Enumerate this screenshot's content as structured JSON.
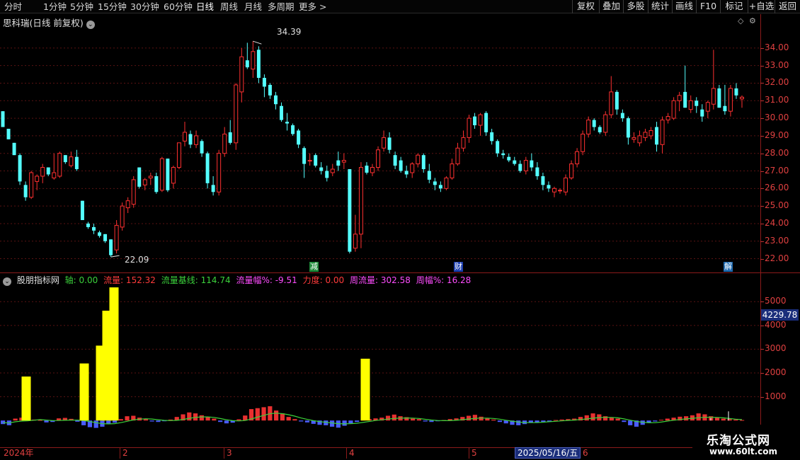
{
  "toolbar": {
    "periods": [
      "分时",
      "1分钟",
      "5分钟",
      "15分钟",
      "30分钟",
      "60分钟",
      "日线",
      "周线",
      "月线",
      "多周期",
      "更多 >"
    ],
    "active_period": "日线",
    "actions": [
      "复权",
      "叠加",
      "多股",
      "统计",
      "画线",
      "F10",
      "+自选",
      "标记",
      "返回"
    ]
  },
  "price_panel": {
    "title": "思科瑞(日线 前复权)",
    "y_labels": [
      "34.00",
      "33.00",
      "32.00",
      "31.00",
      "30.00",
      "29.00",
      "28.00",
      "27.00",
      "26.00",
      "25.00",
      "24.00",
      "23.00",
      "22.00"
    ],
    "high_marker": "34.39",
    "low_marker": "22.09",
    "events": [
      {
        "label": "减",
        "color": "#1f8a3a"
      },
      {
        "label": "财",
        "color": "#1e40b0"
      },
      {
        "label": "解",
        "color": "#1f6ab0"
      }
    ]
  },
  "indicator_panel": {
    "name": "股朋指标网",
    "legend": [
      {
        "label": "轴: 0.00",
        "color": "#3bd13b"
      },
      {
        "label": "流量: 152.32",
        "color": "#ff3b3b"
      },
      {
        "label": "流量基线: 114.74",
        "color": "#3bd13b"
      },
      {
        "label": "流量幅%: -9.51",
        "color": "#ff4cff"
      },
      {
        "label": "力度: 0.00",
        "color": "#ff3b3b"
      },
      {
        "label": "周流量: 302.58",
        "color": "#ff4cff"
      },
      {
        "label": "周幅%: 16.28",
        "color": "#ff4cff"
      }
    ],
    "y_labels": [
      "5000",
      "4000",
      "3000",
      "2000",
      "1000"
    ],
    "current_value": "4229.78"
  },
  "date_axis": {
    "labels": [
      "2024年",
      "2",
      "3",
      "4",
      "5",
      "6"
    ],
    "cursor_date": "2025/05/16/五"
  },
  "watermark": {
    "line1": "乐淘公式网",
    "line2": "www.60lt.com"
  },
  "colors": {
    "up": "#ff3030",
    "down": "#54ffff",
    "spike": "#ffff00",
    "neg_bar": "#4a5cff",
    "baseline": "#3bd13b"
  },
  "chart_data": {
    "type": "candlestick",
    "ylim": [
      21.7,
      34.8
    ],
    "candles": [
      [
        30.4,
        30.4,
        29.5,
        29.5
      ],
      [
        29.4,
        29.4,
        28.8,
        28.8
      ],
      [
        28.6,
        28.6,
        27.9,
        27.9
      ],
      [
        27.9,
        28.0,
        26.2,
        26.4
      ],
      [
        26.2,
        26.4,
        25.3,
        25.5
      ],
      [
        25.5,
        27.0,
        25.4,
        26.9
      ],
      [
        26.4,
        26.8,
        25.9,
        26.7
      ],
      [
        26.7,
        27.4,
        26.3,
        27.2
      ],
      [
        27.2,
        27.2,
        26.7,
        26.8
      ],
      [
        26.6,
        28.0,
        26.5,
        26.9
      ],
      [
        26.7,
        28.1,
        26.6,
        28.0
      ],
      [
        27.9,
        27.9,
        27.4,
        27.5
      ],
      [
        27.3,
        28.1,
        27.2,
        27.8
      ],
      [
        27.8,
        28.2,
        27.0,
        27.1
      ],
      [
        25.3,
        25.3,
        24.3,
        24.2
      ],
      [
        24.0,
        24.1,
        23.7,
        23.8
      ],
      [
        23.8,
        24.0,
        23.4,
        23.6
      ],
      [
        23.5,
        23.6,
        23.2,
        23.3
      ],
      [
        23.4,
        23.4,
        22.9,
        23.0
      ],
      [
        23.1,
        23.1,
        22.1,
        22.2
      ],
      [
        22.5,
        24.2,
        22.3,
        23.9
      ],
      [
        23.8,
        25.2,
        23.6,
        25.0
      ],
      [
        24.9,
        25.5,
        24.6,
        25.3
      ],
      [
        25.1,
        26.7,
        24.9,
        26.5
      ],
      [
        27.2,
        27.2,
        26.0,
        26.1
      ],
      [
        26.2,
        26.6,
        25.9,
        26.5
      ],
      [
        26.6,
        26.9,
        26.2,
        26.7
      ],
      [
        26.7,
        26.9,
        25.7,
        25.8
      ],
      [
        25.9,
        27.8,
        25.8,
        27.7
      ],
      [
        27.7,
        27.7,
        25.8,
        25.9
      ],
      [
        26.3,
        27.3,
        26.0,
        27.2
      ],
      [
        27.2,
        28.6,
        27.1,
        28.6
      ],
      [
        28.7,
        29.8,
        28.4,
        29.2
      ],
      [
        29.1,
        29.3,
        28.3,
        28.5
      ],
      [
        28.5,
        29.3,
        28.3,
        29.0
      ],
      [
        28.7,
        28.8,
        27.8,
        28.0
      ],
      [
        28.0,
        28.1,
        26.0,
        26.3
      ],
      [
        26.2,
        26.7,
        25.6,
        25.8
      ],
      [
        25.8,
        28.2,
        25.6,
        28.0
      ],
      [
        28.0,
        29.5,
        27.8,
        29.1
      ],
      [
        29.2,
        29.9,
        28.5,
        28.6
      ],
      [
        28.6,
        32.0,
        28.2,
        31.9
      ],
      [
        31.5,
        34.0,
        30.9,
        33.5
      ],
      [
        33.3,
        34.3,
        32.8,
        32.9
      ],
      [
        32.8,
        34.39,
        32.3,
        33.8
      ],
      [
        33.9,
        34.1,
        32.0,
        32.3
      ],
      [
        32.3,
        32.5,
        31.2,
        31.8
      ],
      [
        31.9,
        32.0,
        31.1,
        31.3
      ],
      [
        31.3,
        31.5,
        30.5,
        30.8
      ],
      [
        30.7,
        30.9,
        29.8,
        29.9
      ],
      [
        29.8,
        30.3,
        29.3,
        29.7
      ],
      [
        29.6,
        29.7,
        29.0,
        29.1
      ],
      [
        29.3,
        29.4,
        28.3,
        28.5
      ],
      [
        28.3,
        28.4,
        26.6,
        27.4
      ],
      [
        27.6,
        28.0,
        27.3,
        27.6
      ],
      [
        27.9,
        28.0,
        27.2,
        27.3
      ],
      [
        27.2,
        27.5,
        26.8,
        27.0
      ],
      [
        27.0,
        27.3,
        26.4,
        26.6
      ],
      [
        26.9,
        27.4,
        26.7,
        27.1
      ],
      [
        27.6,
        28.1,
        27.0,
        27.3
      ],
      [
        27.5,
        28.0,
        27.1,
        27.6
      ],
      [
        27.1,
        27.1,
        22.3,
        22.4
      ],
      [
        22.6,
        24.5,
        22.4,
        23.4
      ],
      [
        23.4,
        27.5,
        22.6,
        27.2
      ],
      [
        27.3,
        27.5,
        26.8,
        26.9
      ],
      [
        26.9,
        27.4,
        26.7,
        27.2
      ],
      [
        27.2,
        28.4,
        27.0,
        28.2
      ],
      [
        28.3,
        29.3,
        28.1,
        28.9
      ],
      [
        28.9,
        29.2,
        28.0,
        28.2
      ],
      [
        27.9,
        28.1,
        27.1,
        27.3
      ],
      [
        27.6,
        27.8,
        26.9,
        27.0
      ],
      [
        27.0,
        27.3,
        26.6,
        26.8
      ],
      [
        26.9,
        27.5,
        26.6,
        27.4
      ],
      [
        27.4,
        28.0,
        27.2,
        27.9
      ],
      [
        27.9,
        28.0,
        26.9,
        27.1
      ],
      [
        27.0,
        27.4,
        26.3,
        26.5
      ],
      [
        26.4,
        26.6,
        25.9,
        26.2
      ],
      [
        26.2,
        26.4,
        25.8,
        26.0
      ],
      [
        26.0,
        26.7,
        25.9,
        26.6
      ],
      [
        26.6,
        27.7,
        26.5,
        27.4
      ],
      [
        27.4,
        28.6,
        27.3,
        28.3
      ],
      [
        28.3,
        29.3,
        28.1,
        28.9
      ],
      [
        28.9,
        30.2,
        28.6,
        30.0
      ],
      [
        30.1,
        30.3,
        29.4,
        29.6
      ],
      [
        29.6,
        30.3,
        29.0,
        30.2
      ],
      [
        30.3,
        30.4,
        29.0,
        29.2
      ],
      [
        29.2,
        29.4,
        28.5,
        28.7
      ],
      [
        28.7,
        28.8,
        27.8,
        28.0
      ],
      [
        28.0,
        28.2,
        27.7,
        27.9
      ],
      [
        27.8,
        28.0,
        27.5,
        27.6
      ],
      [
        27.6,
        27.8,
        27.3,
        27.4
      ],
      [
        27.4,
        27.6,
        26.9,
        27.0
      ],
      [
        27.0,
        27.8,
        26.8,
        27.6
      ],
      [
        27.6,
        28.0,
        27.0,
        27.2
      ],
      [
        27.2,
        27.5,
        26.5,
        26.7
      ],
      [
        26.7,
        26.9,
        25.9,
        26.2
      ],
      [
        26.2,
        26.4,
        25.8,
        26.0
      ],
      [
        25.8,
        26.1,
        25.5,
        26.0
      ],
      [
        25.9,
        26.0,
        25.7,
        25.9
      ],
      [
        25.8,
        26.8,
        25.6,
        26.6
      ],
      [
        26.6,
        27.6,
        26.5,
        27.4
      ],
      [
        27.4,
        28.3,
        27.2,
        28.1
      ],
      [
        28.1,
        29.3,
        27.9,
        29.1
      ],
      [
        29.1,
        30.1,
        28.9,
        29.9
      ],
      [
        29.9,
        30.0,
        29.3,
        29.5
      ],
      [
        29.5,
        29.6,
        29.1,
        29.2
      ],
      [
        29.2,
        30.4,
        29.0,
        30.2
      ],
      [
        30.2,
        32.4,
        30.0,
        31.5
      ],
      [
        31.5,
        31.6,
        30.2,
        30.5
      ],
      [
        30.3,
        30.5,
        29.8,
        30.0
      ],
      [
        30.0,
        30.1,
        28.5,
        28.9
      ],
      [
        28.8,
        29.2,
        28.6,
        28.9
      ],
      [
        28.6,
        29.3,
        28.4,
        29.0
      ],
      [
        28.9,
        29.4,
        28.7,
        29.2
      ],
      [
        29.0,
        29.5,
        28.8,
        29.3
      ],
      [
        29.5,
        29.8,
        28.1,
        28.5
      ],
      [
        28.5,
        30.1,
        28.0,
        29.9
      ],
      [
        29.9,
        30.3,
        29.7,
        30.1
      ],
      [
        30.0,
        31.2,
        29.9,
        31.0
      ],
      [
        31.0,
        31.5,
        30.4,
        31.3
      ],
      [
        31.5,
        33.0,
        30.6,
        30.6
      ],
      [
        30.5,
        31.3,
        30.3,
        31.0
      ],
      [
        31.0,
        31.2,
        30.3,
        30.7
      ],
      [
        30.5,
        30.8,
        29.8,
        30.1
      ],
      [
        30.4,
        31.0,
        30.0,
        30.9
      ],
      [
        30.8,
        33.9,
        30.5,
        31.7
      ],
      [
        31.7,
        31.9,
        30.6,
        30.6
      ],
      [
        30.7,
        31.9,
        30.2,
        30.4
      ],
      [
        30.4,
        31.9,
        30.1,
        31.7
      ],
      [
        31.7,
        32.0,
        31.1,
        31.3
      ],
      [
        31.1,
        31.3,
        30.6,
        31.2
      ]
    ],
    "indicator": {
      "ylim": [
        -500,
        5900
      ],
      "spikes": [
        [
          1,
          1850
        ],
        [
          4,
          2400
        ],
        [
          5,
          3150
        ],
        [
          6,
          4620
        ],
        [
          7,
          5600
        ],
        [
          17,
          2600
        ]
      ],
      "flow": [
        -150,
        -200,
        80,
        120,
        60,
        40,
        20,
        -80,
        -60,
        90,
        110,
        70,
        -50,
        -200,
        -280,
        -310,
        -260,
        -150,
        -90,
        60,
        180,
        200,
        120,
        60,
        -40,
        -60,
        -30,
        40,
        150,
        260,
        340,
        300,
        220,
        150,
        80,
        -60,
        -120,
        -90,
        50,
        210,
        480,
        520,
        560,
        600,
        420,
        300,
        150,
        60,
        -40,
        -80,
        -140,
        -180,
        -200,
        -260,
        -300,
        -220,
        -120,
        -60,
        30,
        60,
        90,
        120,
        200,
        250,
        180,
        140,
        80,
        60,
        -40,
        -60,
        -30,
        20,
        60,
        90,
        150,
        200,
        240,
        160,
        90,
        40,
        -60,
        -120,
        -180,
        -200,
        -150,
        -100,
        -80,
        -60,
        -40,
        20,
        40,
        60,
        80,
        150,
        220,
        300,
        260,
        180,
        120,
        80,
        -60,
        -200,
        -260,
        -180,
        -90,
        -40,
        30,
        80,
        120,
        160,
        180,
        220,
        300,
        260,
        180,
        120,
        80,
        60,
        40,
        20
      ]
    }
  }
}
